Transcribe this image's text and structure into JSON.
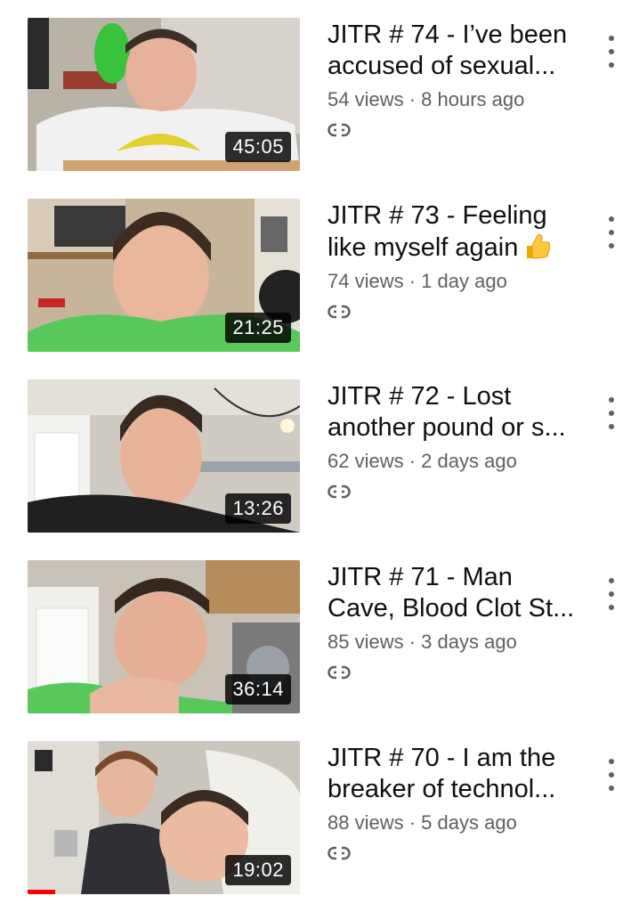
{
  "videos": [
    {
      "title_line1": "JITR # 74 - I’ve been",
      "title_line2": "accused of sexual...",
      "views": "54 views",
      "sep": "·",
      "age": "8 hours ago",
      "duration": "45:05"
    },
    {
      "title_line1": "JITR # 73 - Feeling",
      "title_line2": "like myself again",
      "title_emoji": "thumbs-up",
      "views": "74 views",
      "sep": "·",
      "age": "1 day ago",
      "duration": "21:25"
    },
    {
      "title_line1": "JITR # 72 - Lost",
      "title_line2": "another pound or s...",
      "views": "62 views",
      "sep": "·",
      "age": "2 days ago",
      "duration": "13:26"
    },
    {
      "title_line1": "JITR # 71 - Man",
      "title_line2": "Cave, Blood Clot St...",
      "views": "85 views",
      "sep": "·",
      "age": "3 days ago",
      "duration": "36:14"
    },
    {
      "title_line1": "JITR # 70 - I am the",
      "title_line2": "breaker of technol...",
      "views": "88 views",
      "sep": "·",
      "age": "5 days ago",
      "duration": "19:02",
      "watched_fraction": 0.1
    }
  ],
  "icons": {
    "more": "more-vert-icon",
    "link": "link-icon",
    "emoji": "thumbs-up-emoji"
  },
  "colors": {
    "title": "#0f0f0f",
    "meta": "#606060",
    "progress": "#ff0000"
  }
}
